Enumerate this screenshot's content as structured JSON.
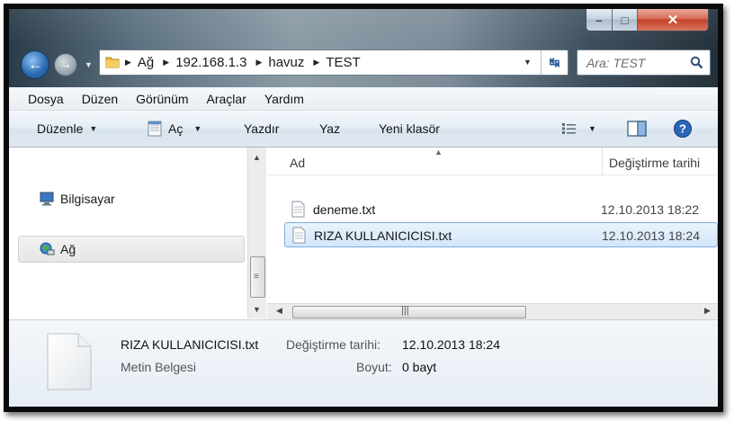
{
  "window": {
    "caption": {
      "minimize": "–",
      "maximize": "□",
      "close": "✕"
    }
  },
  "address_bar": {
    "breadcrumbs": [
      "Ağ",
      "192.168.1.3",
      "havuz",
      "TEST"
    ],
    "search_placeholder": "Ara: TEST"
  },
  "menu": [
    "Dosya",
    "Düzen",
    "Görünüm",
    "Araçlar",
    "Yardım"
  ],
  "toolbar": {
    "organize": "Düzenle",
    "open": "Aç",
    "print": "Yazdır",
    "write": "Yaz",
    "new_folder": "Yeni klasör"
  },
  "nav_pane": {
    "items": [
      {
        "label": "Bilgisayar",
        "icon": "computer-icon"
      },
      {
        "label": "Ağ",
        "icon": "network-icon",
        "selected": true
      }
    ]
  },
  "file_list": {
    "columns": [
      "Ad",
      "Değiştirme tarihi"
    ],
    "rows": [
      {
        "name": "deneme.txt",
        "modified": "12.10.2013 18:22",
        "selected": false
      },
      {
        "name": "RIZA KULLANICICISI.txt",
        "modified": "12.10.2013 18:24",
        "selected": true
      }
    ]
  },
  "details": {
    "name": "RIZA KULLANICICISI.txt",
    "type": "Metin Belgesi",
    "modified_label": "Değiştirme tarihi:",
    "modified_value": "12.10.2013 18:24",
    "size_label": "Boyut:",
    "size_value": "0 bayt"
  },
  "colors": {
    "accent": "#2d6db3",
    "selection_fill": "#d3e6fa",
    "selection_border": "#84acdd",
    "close_button": "#c0381d"
  }
}
